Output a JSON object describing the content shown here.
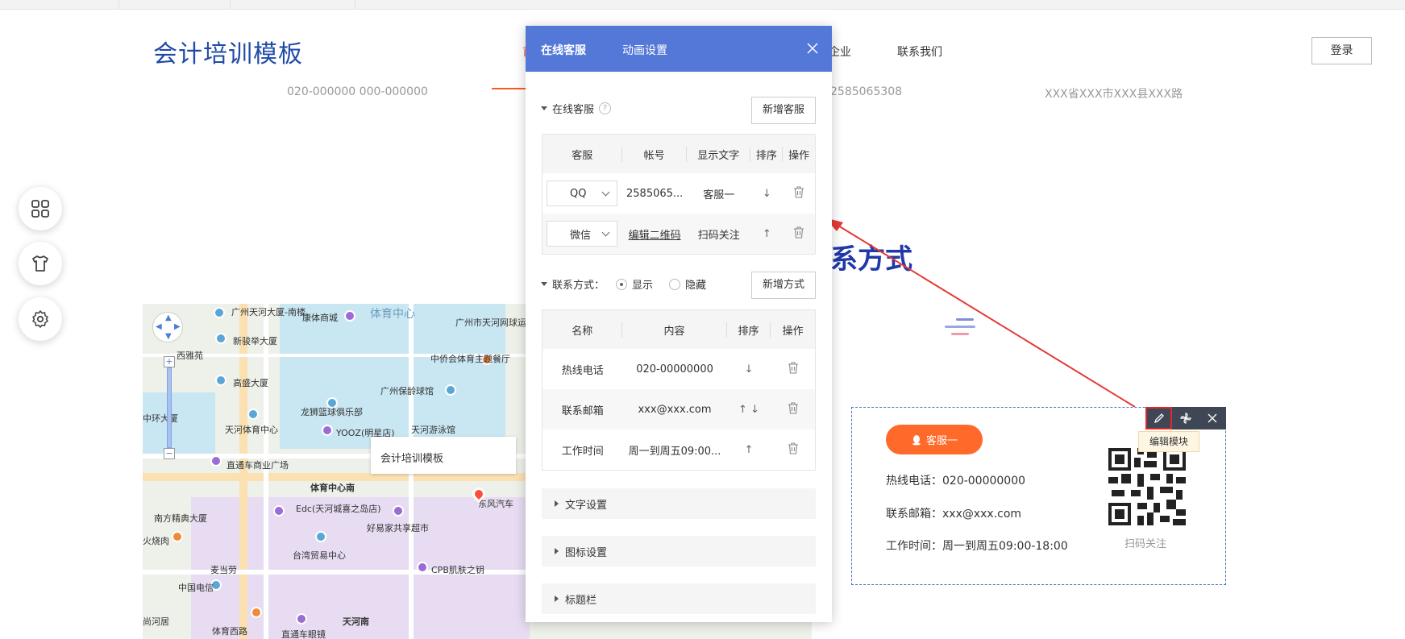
{
  "site": {
    "title": "会计培训模板",
    "nav": [
      "企业",
      "联系我们"
    ],
    "nav_first_fragment": "首",
    "login": "登录",
    "cut_texts": [
      "020-000000 000-000000",
      "2585065308",
      "XXX省XXX市XXX县XXX路"
    ],
    "contact_heading": "系方式"
  },
  "side_buttons": [
    "grid-icon",
    "shirt-icon",
    "gear-icon"
  ],
  "map": {
    "callout": "会计培训模板",
    "labels": [
      "广州天河大厦-南楼",
      "康体商城",
      "体育中心",
      "广州市天河网球运动学校",
      "新骏举大厦",
      "西雅苑",
      "中侨会体育主题餐厅",
      "高盛大厦",
      "广州保龄球馆",
      "龙狮篮球俱乐部",
      "中环大厦",
      "天河体育中心",
      "YOOZ(明星店)",
      "天河游泳馆",
      "直通车商业广场",
      "体育中心南",
      "东风汽车",
      "Edc(天河城喜之岛店)",
      "好易家共享超市",
      "南方精典大厦",
      "火烧肉",
      "台湾贸易中心",
      "CPB肌肤之钥",
      "麦当劳",
      "中国电信",
      "尚河居",
      "体育西路",
      "直通车眼镜",
      "天河南"
    ]
  },
  "module": {
    "kefu_button": "客服一",
    "lines": [
      "热线电话：020-00000000",
      "联系邮箱：xxx@xxx.com",
      "工作时间：周一到周五09:00-18:00"
    ],
    "qr_caption": "扫码关注",
    "tooltip": "编辑模块"
  },
  "dialog": {
    "tabs": [
      "在线客服",
      "动画设置"
    ],
    "kefu_section": "在线客服",
    "help": "?",
    "add_kefu": "新增客服",
    "kefu_headers": [
      "客服",
      "帐号",
      "显示文字",
      "排序",
      "操作"
    ],
    "kefu_rows": [
      {
        "type": "QQ",
        "account": "2585065...",
        "text": "客服一",
        "sort": "↓"
      },
      {
        "type": "微信",
        "account": "编辑二维码",
        "text": "扫码关注",
        "sort": "↑"
      }
    ],
    "contact_section": "联系方式：",
    "show": "显示",
    "hide": "隐藏",
    "add_contact": "新增方式",
    "contact_headers": [
      "名称",
      "内容",
      "排序",
      "操作"
    ],
    "contact_rows": [
      {
        "name": "热线电话",
        "content": "020-00000000",
        "sort": "↓"
      },
      {
        "name": "联系邮箱",
        "content": "xxx@xxx.com",
        "sort": "↑ ↓"
      },
      {
        "name": "工作时间",
        "content": "周一到周五09:00...",
        "sort": "↑"
      }
    ],
    "collapsed": [
      "文字设置",
      "图标设置",
      "标题栏"
    ]
  },
  "colors": {
    "primary": "#5478d8",
    "accent": "#ff6a2b",
    "heading": "#2138a8",
    "annotation": "#e02a2a"
  }
}
